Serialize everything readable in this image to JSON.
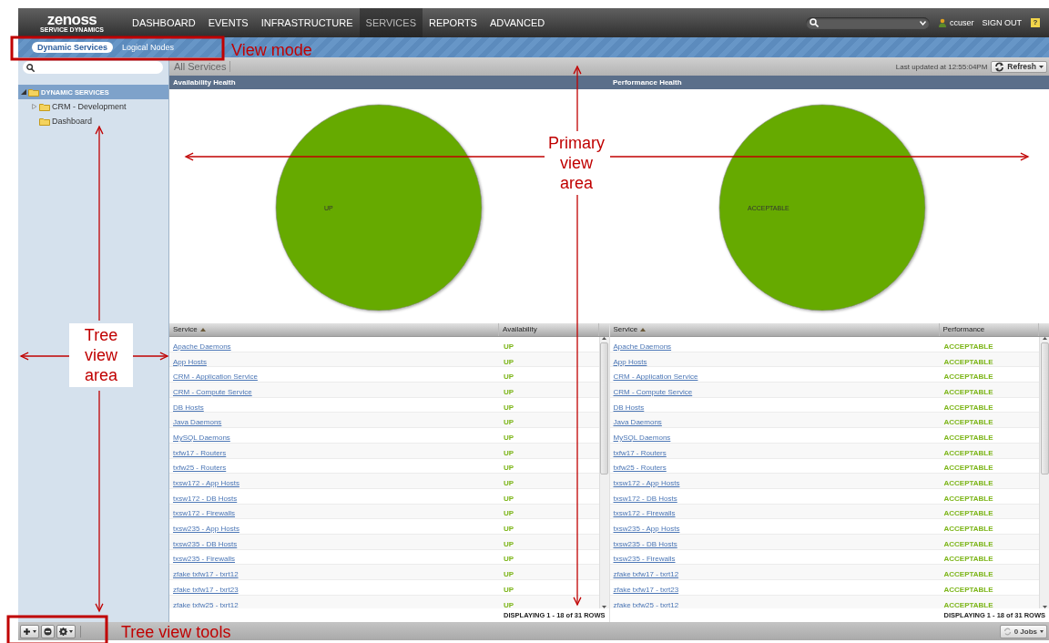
{
  "logo": {
    "name": "zenoss",
    "tagline": "SERVICE DYNAMICS"
  },
  "nav": [
    {
      "label": "DASHBOARD",
      "selected": false
    },
    {
      "label": "EVENTS",
      "selected": false
    },
    {
      "label": "INFRASTRUCTURE",
      "selected": false
    },
    {
      "label": "SERVICES",
      "selected": true
    },
    {
      "label": "REPORTS",
      "selected": false
    },
    {
      "label": "ADVANCED",
      "selected": false
    }
  ],
  "user": {
    "name": "ccuser",
    "sign_out": "SIGN OUT",
    "help": "?"
  },
  "view_modes": [
    {
      "label": "Dynamic Services",
      "selected": true
    },
    {
      "label": "Logical Nodes",
      "selected": false
    }
  ],
  "sidebar": {
    "tree": [
      {
        "label": "DYNAMIC SERVICES",
        "expanded": true,
        "selected": true,
        "children": [
          {
            "label": "CRM - Development",
            "expanded": false,
            "selected": false
          },
          {
            "label": "Dashboard",
            "selected": false
          }
        ]
      }
    ]
  },
  "toolbar": {
    "title": "All Services",
    "last_updated": "Last updated at 12:55:04PM",
    "refresh": "Refresh"
  },
  "panels": [
    {
      "title": "Availability Health",
      "slice_label": "UP"
    },
    {
      "title": "Performance Health",
      "slice_label": "ACCEPTABLE"
    }
  ],
  "grids": [
    {
      "columns": [
        {
          "label": "Service",
          "sorted": true
        },
        {
          "label": "Availability",
          "sorted": false
        }
      ],
      "footer": "DISPLAYING 1 - 18 of 31 ROWS",
      "rows": [
        {
          "service": "Apache Daemons",
          "status": "UP"
        },
        {
          "service": "App Hosts",
          "status": "UP"
        },
        {
          "service": "CRM - Application Service",
          "status": "UP"
        },
        {
          "service": "CRM - Compute Service",
          "status": "UP"
        },
        {
          "service": "DB Hosts",
          "status": "UP"
        },
        {
          "service": "Java Daemons",
          "status": "UP"
        },
        {
          "service": "MySQL Daemons",
          "status": "UP"
        },
        {
          "service": "txfw17 - Routers",
          "status": "UP"
        },
        {
          "service": "txfw25 - Routers",
          "status": "UP"
        },
        {
          "service": "txsw172 - App Hosts",
          "status": "UP"
        },
        {
          "service": "txsw172 - DB Hosts",
          "status": "UP"
        },
        {
          "service": "txsw172 - Firewalls",
          "status": "UP"
        },
        {
          "service": "txsw235 - App Hosts",
          "status": "UP"
        },
        {
          "service": "txsw235 - DB Hosts",
          "status": "UP"
        },
        {
          "service": "txsw235 - Firewalls",
          "status": "UP"
        },
        {
          "service": "zfake txfw17 - txrt12",
          "status": "UP"
        },
        {
          "service": "zfake txfw17 - txrt23",
          "status": "UP"
        },
        {
          "service": "zfake txfw25 - txrt12",
          "status": "UP"
        }
      ]
    },
    {
      "columns": [
        {
          "label": "Service",
          "sorted": true
        },
        {
          "label": "Performance",
          "sorted": false
        }
      ],
      "footer": "DISPLAYING 1 - 18 of 31 ROWS",
      "rows": [
        {
          "service": "Apache Daemons",
          "status": "ACCEPTABLE"
        },
        {
          "service": "App Hosts",
          "status": "ACCEPTABLE"
        },
        {
          "service": "CRM - Application Service",
          "status": "ACCEPTABLE"
        },
        {
          "service": "CRM - Compute Service",
          "status": "ACCEPTABLE"
        },
        {
          "service": "DB Hosts",
          "status": "ACCEPTABLE"
        },
        {
          "service": "Java Daemons",
          "status": "ACCEPTABLE"
        },
        {
          "service": "MySQL Daemons",
          "status": "ACCEPTABLE"
        },
        {
          "service": "txfw17 - Routers",
          "status": "ACCEPTABLE"
        },
        {
          "service": "txfw25 - Routers",
          "status": "ACCEPTABLE"
        },
        {
          "service": "txsw172 - App Hosts",
          "status": "ACCEPTABLE"
        },
        {
          "service": "txsw172 - DB Hosts",
          "status": "ACCEPTABLE"
        },
        {
          "service": "txsw172 - Firewalls",
          "status": "ACCEPTABLE"
        },
        {
          "service": "txsw235 - App Hosts",
          "status": "ACCEPTABLE"
        },
        {
          "service": "txsw235 - DB Hosts",
          "status": "ACCEPTABLE"
        },
        {
          "service": "txsw235 - Firewalls",
          "status": "ACCEPTABLE"
        },
        {
          "service": "zfake txfw17 - txrt12",
          "status": "ACCEPTABLE"
        },
        {
          "service": "zfake txfw17 - txrt23",
          "status": "ACCEPTABLE"
        },
        {
          "service": "zfake txfw25 - txrt12",
          "status": "ACCEPTABLE"
        }
      ]
    }
  ],
  "bottom_bar": {
    "tools": [
      {
        "kind": "add"
      },
      {
        "kind": "remove"
      },
      {
        "kind": "settings"
      }
    ],
    "jobs": "0 Jobs"
  },
  "annotations": [
    {
      "kind": "boxed",
      "text": "View mode"
    },
    {
      "kind": "cross",
      "text": "Primary view area"
    },
    {
      "kind": "cross",
      "text": "Tree view area"
    },
    {
      "kind": "boxed",
      "text": "Tree view tools"
    }
  ]
}
